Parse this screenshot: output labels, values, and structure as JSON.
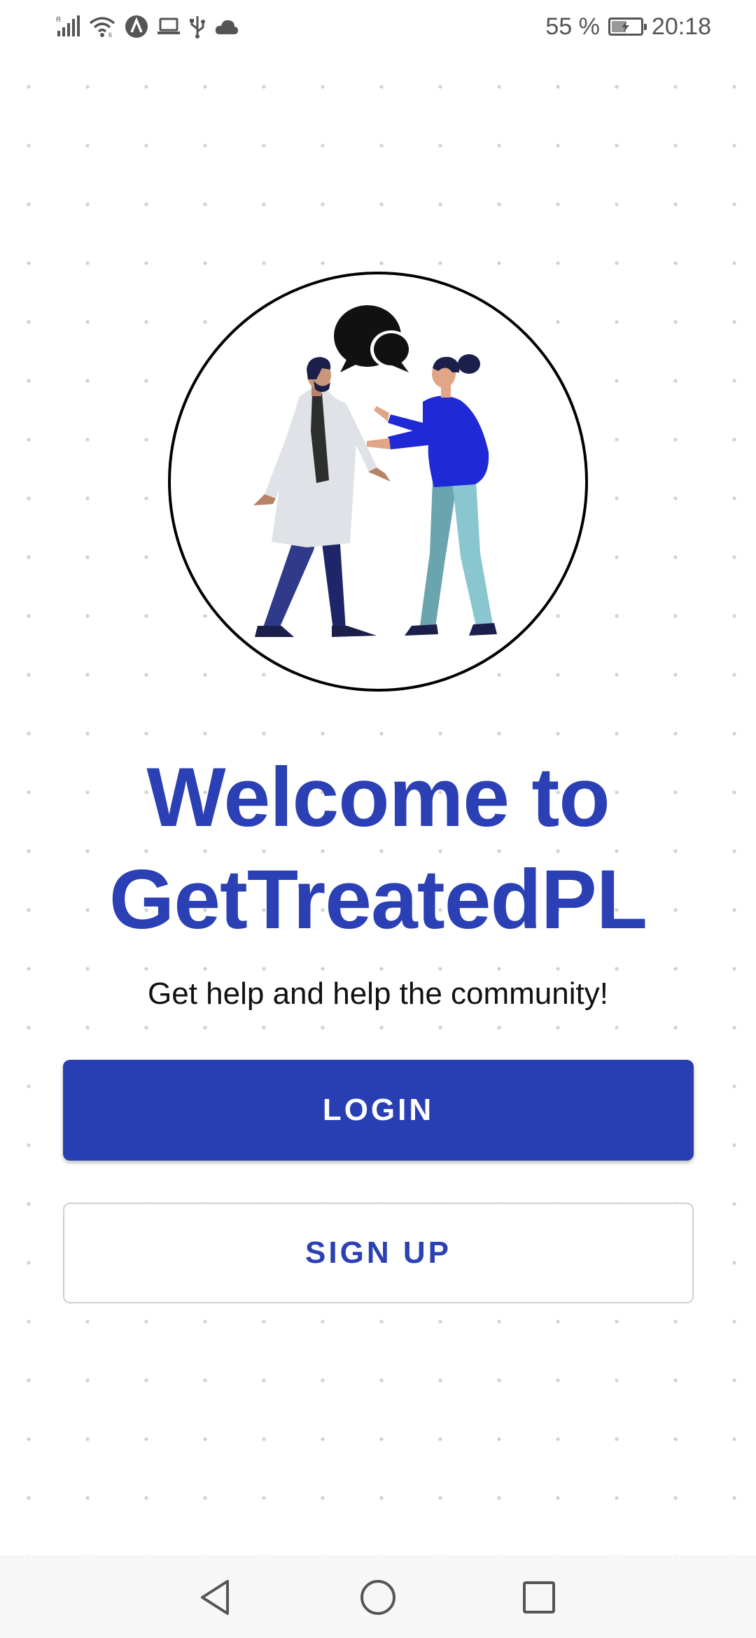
{
  "status_bar": {
    "battery_text": "55 %",
    "battery_level": 0.55,
    "time": "20:18",
    "icons": [
      "signal-icon",
      "wifi-icon",
      "app-notification-icon",
      "laptop-icon",
      "usb-icon",
      "cloud-icon",
      "battery-icon"
    ]
  },
  "hero": {
    "icon": "doctor-patient-illustration"
  },
  "welcome": {
    "line1": "Welcome to",
    "line2": "GetTreatedPL",
    "tagline": "Get help and help the community!"
  },
  "actions": {
    "login_label": "LOGIN",
    "signup_label": "SIGN UP"
  },
  "nav": {
    "icons": [
      "back-icon",
      "home-icon",
      "recents-icon"
    ]
  },
  "colors": {
    "brand": "#2a40b4",
    "button": "#283fb3",
    "text": "#111111"
  }
}
